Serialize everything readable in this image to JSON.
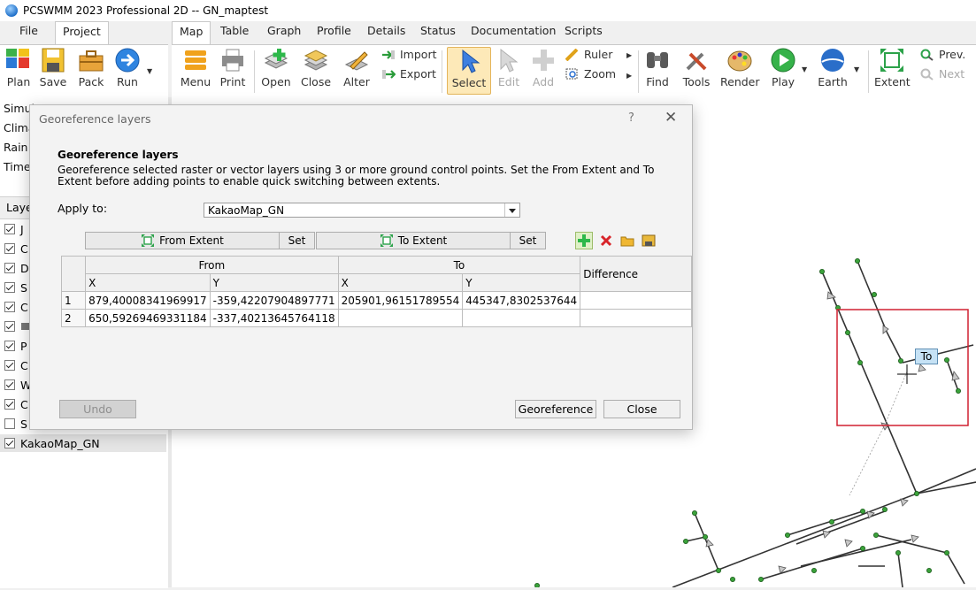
{
  "window": {
    "title": "PCSWMM 2023 Professional 2D -- GN_maptest"
  },
  "left_ribbon": {
    "tabs": [
      {
        "label": "File",
        "active": false
      },
      {
        "label": "Project",
        "active": true
      }
    ],
    "buttons": [
      {
        "label": "Plan",
        "icon": "plan-icon"
      },
      {
        "label": "Save",
        "icon": "save-icon"
      },
      {
        "label": "Pack",
        "icon": "pack-icon"
      },
      {
        "label": "Run",
        "icon": "run-icon"
      }
    ]
  },
  "map_ribbon": {
    "tabs": [
      {
        "label": "Map",
        "active": true
      },
      {
        "label": "Table"
      },
      {
        "label": "Graph"
      },
      {
        "label": "Profile"
      },
      {
        "label": "Details"
      },
      {
        "label": "Status"
      },
      {
        "label": "Documentation"
      },
      {
        "label": "Scripts"
      }
    ],
    "buttons": {
      "menu": "Menu",
      "print": "Print",
      "open": "Open",
      "close": "Close",
      "alter": "Alter",
      "import": "Import",
      "export": "Export",
      "select": "Select",
      "edit": "Edit",
      "add": "Add",
      "ruler": "Ruler",
      "zoom": "Zoom",
      "find": "Find",
      "tools": "Tools",
      "render": "Render",
      "play": "Play",
      "earth": "Earth",
      "extent": "Extent",
      "prev": "Prev.",
      "next": "Next"
    }
  },
  "sim_panel": {
    "rows": [
      "Simul",
      "Clima",
      "Rain",
      "Time"
    ]
  },
  "layers_panel": {
    "header": "Laye",
    "items": [
      {
        "label": "J",
        "checked": true
      },
      {
        "label": "C",
        "checked": true
      },
      {
        "label": "D",
        "checked": true
      },
      {
        "label": "S",
        "checked": true
      },
      {
        "label": "C",
        "checked": true
      },
      {
        "label": "",
        "checked": true
      },
      {
        "label": "P",
        "checked": true
      },
      {
        "label": "C",
        "checked": true
      },
      {
        "label": "W",
        "checked": true
      },
      {
        "label": "C",
        "checked": true
      },
      {
        "label": "S",
        "checked": false
      },
      {
        "label": "KakaoMap_GN",
        "checked": true
      }
    ]
  },
  "dialog": {
    "title": "Georeference layers",
    "help": "?",
    "heading": "Georeference layers",
    "description": "Georeference selected raster or vector layers using 3 or more ground control points. Set the From Extent and To Extent before adding points to enable quick switching between extents.",
    "apply_label": "Apply to:",
    "apply_value": "KakaoMap_GN",
    "from_extent": "From Extent",
    "to_extent": "To Extent",
    "set": "Set",
    "table": {
      "from_header": "From",
      "to_header": "To",
      "diff_header": "Difference",
      "x": "X",
      "y": "Y",
      "rows": [
        {
          "n": "1",
          "fx": "879,40008341969917",
          "fy": "-359,42207904897771",
          "tx": "205901,96151789554",
          "ty": "445347,8302537644",
          "diff": ""
        },
        {
          "n": "2",
          "fx": "650,59269469331184",
          "fy": "-337,40213645764118",
          "tx": "",
          "ty": "",
          "diff": ""
        }
      ]
    },
    "undo": "Undo",
    "georeference": "Georeference",
    "close": "Close"
  },
  "map": {
    "marker_label": "To",
    "selection_color": "#d02030",
    "node_color": "#3aa23a"
  }
}
